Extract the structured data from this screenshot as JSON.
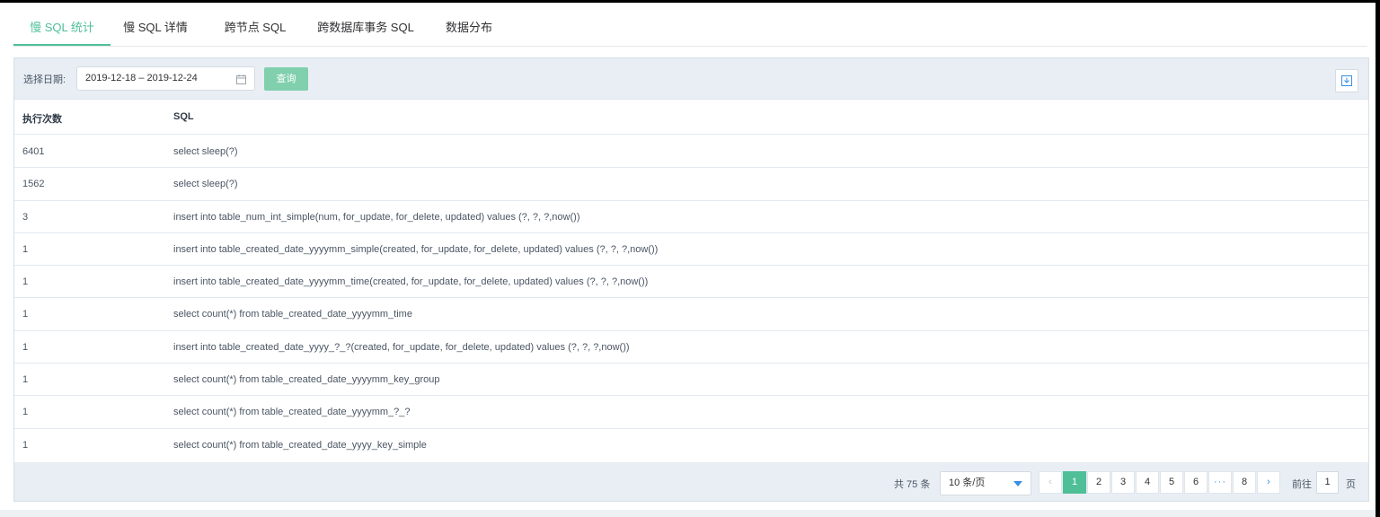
{
  "tabs": [
    {
      "label": "慢 SQL 统计",
      "active": true
    },
    {
      "label": "慢 SQL 详情",
      "active": false
    },
    {
      "label": "跨节点 SQL",
      "active": false
    },
    {
      "label": "跨数据库事务 SQL",
      "active": false
    },
    {
      "label": "数据分布",
      "active": false
    }
  ],
  "toolbar": {
    "date_label": "选择日期:",
    "date_range": "2019-12-18 – 2019-12-24",
    "query_label": "查询",
    "calendar_icon": "calendar-icon",
    "export_icon": "download-icon"
  },
  "table": {
    "headers": [
      "执行次数",
      "SQL"
    ],
    "rows": [
      {
        "count": "6401",
        "sql": "select sleep(?)"
      },
      {
        "count": "1562",
        "sql": "select sleep(?)"
      },
      {
        "count": "3",
        "sql": "insert into table_num_int_simple(num, for_update, for_delete, updated) values (?, ?, ?,now())"
      },
      {
        "count": "1",
        "sql": "insert into table_created_date_yyyymm_simple(created, for_update, for_delete, updated) values (?, ?, ?,now())"
      },
      {
        "count": "1",
        "sql": "insert into table_created_date_yyyymm_time(created, for_update, for_delete, updated) values (?, ?, ?,now())"
      },
      {
        "count": "1",
        "sql": "select count(*) from table_created_date_yyyymm_time"
      },
      {
        "count": "1",
        "sql": "insert into table_created_date_yyyy_?_?(created, for_update, for_delete, updated) values (?, ?, ?,now())"
      },
      {
        "count": "1",
        "sql": "select count(*) from table_created_date_yyyymm_key_group"
      },
      {
        "count": "1",
        "sql": "select count(*) from table_created_date_yyyymm_?_?"
      },
      {
        "count": "1",
        "sql": "select count(*) from table_created_date_yyyy_key_simple"
      }
    ]
  },
  "pagination": {
    "total_text": "共 75 条",
    "page_size": "10 条/页",
    "prev_icon": "‹",
    "next_icon": "›",
    "pages": [
      "1",
      "2",
      "3",
      "4",
      "5",
      "6",
      "···",
      "8"
    ],
    "current_page": "1",
    "goto_label": "前往",
    "goto_value": "1",
    "goto_suffix": "页"
  },
  "colors": {
    "accent": "#4fbf98",
    "link": "#3a8ee6",
    "toolbar_bg": "#e8eef4"
  }
}
